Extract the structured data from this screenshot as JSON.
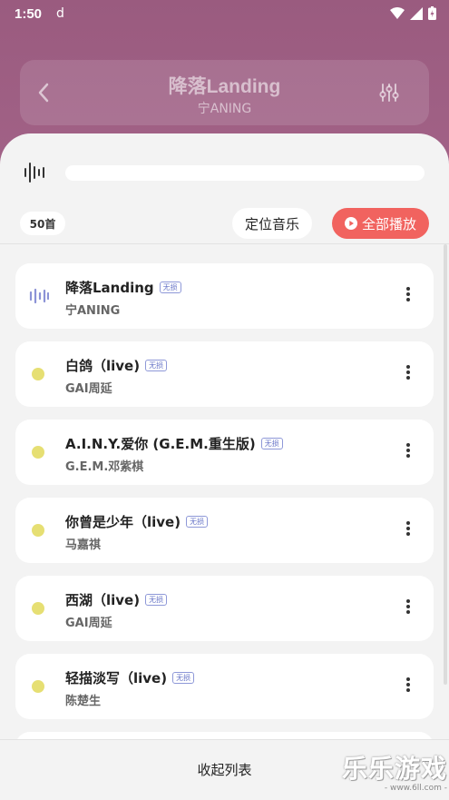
{
  "status_bar": {
    "time": "1:50",
    "app_glyph": "d",
    "icons": [
      "wifi-icon",
      "signal-icon",
      "battery-icon"
    ]
  },
  "header": {
    "title": "降落Landing",
    "artist": "宁ANING",
    "back_icon": "chevron-left-icon",
    "eq_icon": "equalizer-icon"
  },
  "toolbar": {
    "count_label": "50首",
    "locate_label": "定位音乐",
    "play_all_label": "全部播放",
    "accent_color": "#f1635f"
  },
  "songs": [
    {
      "title": "降落Landing",
      "artist": "宁ANING",
      "tag": "无损",
      "playing": true
    },
    {
      "title": "白鸽（live)",
      "artist": "GAI周延",
      "tag": "无损",
      "playing": false
    },
    {
      "title": "A.I.N.Y.爱你 (G.E.M.重生版)",
      "artist": "G.E.M.邓紫棋",
      "tag": "无损",
      "playing": false
    },
    {
      "title": "你曾是少年（live)",
      "artist": "马嘉祺",
      "tag": "无损",
      "playing": false
    },
    {
      "title": "西湖（live)",
      "artist": "GAI周延",
      "tag": "无损",
      "playing": false
    },
    {
      "title": "轻描淡写（live)",
      "artist": "陈楚生",
      "tag": "无损",
      "playing": false
    }
  ],
  "footer": {
    "collapse_label": "收起列表"
  },
  "watermark": {
    "title": "乐乐游戏",
    "url": "- www.6ll.com -"
  }
}
